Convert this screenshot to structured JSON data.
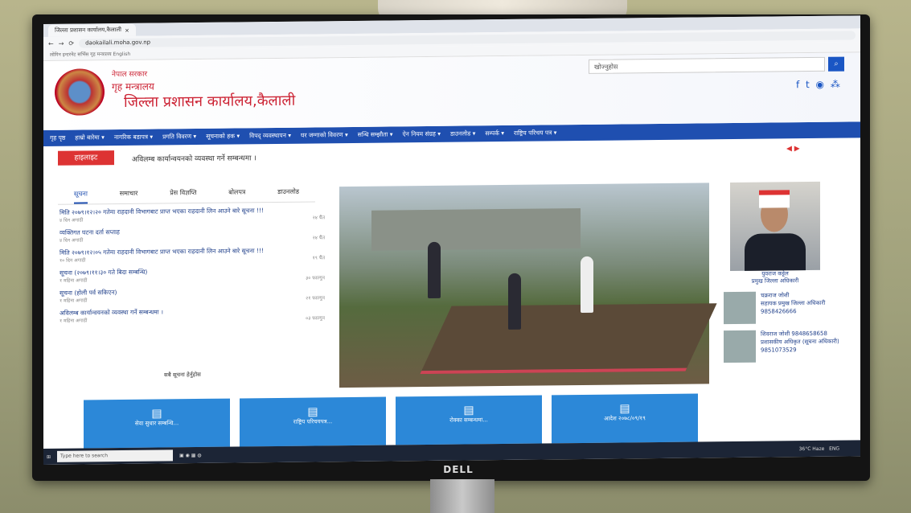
{
  "browser": {
    "tab_title": "जिल्ला प्रशासन कार्यालय,कैलाली",
    "url": "daokailali.moha.gov.np",
    "bookmarks": "लोगिन    इन्टरनेट सर्भिस    गृह मन्त्रालय    English"
  },
  "header": {
    "gov_line1": "नेपाल सरकार",
    "gov_line2": "गृह मन्त्रालय",
    "office": "जिल्ला प्रशासन कार्यालय,कैलाली",
    "search_placeholder": "खोज्नुहोस",
    "search_icon": "search-icon"
  },
  "nav": {
    "items": [
      "गृह पृष्ठ",
      "हाम्रो बारेमा ▾",
      "नागरिक बडापत्र ▾",
      "प्रगति विवरण ▾",
      "सूचनाको हक ▾",
      "विपद् व्यवस्थापन ▾",
      "घर जग्गाको विवरण ▾",
      "सन्धि सम्झौता ▾",
      "ऐन नियम संग्रह ▾",
      "डाउनलोड ▾",
      "सम्पर्क ▾",
      "राष्ट्रिय परिचय पत्र ▾"
    ]
  },
  "highlight": {
    "label": "हाइलाइट",
    "text": "अविलम्ब कार्यान्वयनको व्यवस्था गर्ने सम्बन्धमा ।"
  },
  "tabs": [
    "सूचना",
    "समाचार",
    "प्रेस विज्ञप्ति",
    "बोलपत्र",
    "डाउनलोड"
  ],
  "news": [
    {
      "title": "मिति २०७९।१२।२० गतेमा राहदानी विभागबाट प्राप्त भएका राहदानी लिन आउने बारे सूचना !!!",
      "meta": "४ दिन अगाडी",
      "date": "२४ चैत"
    },
    {
      "title": "व्यक्तिगत घटना दर्ता सप्ताह",
      "meta": "४ दिन अगाडी",
      "date": "२४ चैत"
    },
    {
      "title": "मिति २०७९।१२।०५ गतेमा राहदानी विभागबाट प्राप्त भएका राहदानी लिन आउने बारे सूचना !!!",
      "meta": "१० दिन अगाडी",
      "date": "१९ चैत"
    },
    {
      "title": "सूचना (२०७९।११।३० गते बिदा सम्बन्धि)",
      "meta": "१ महिना अगाडी",
      "date": "३० फाल्गुन"
    },
    {
      "title": "सूचना (होली पर्व सकिएन)",
      "meta": "१ महिना अगाडी",
      "date": "२१ फाल्गुन"
    },
    {
      "title": "अविलम्ब कार्यान्वयनको व्यवस्था गर्ने सम्बन्धमा ।",
      "meta": "१ महिना अगाडी",
      "date": "०३ फाल्गुन"
    }
  ],
  "more_notices": "सबै सूचना हेर्नुहोस",
  "side": {
    "chief_name": "युवराज कट्टेल",
    "chief_title": "प्रमुख जिल्ला अधिकारी",
    "staff1_name": "चक्रराज जोशी",
    "staff1_role": "सहायक प्रमुख जिल्ला अधिकारी",
    "staff1_phone": "9858426666",
    "staff2_name": "शिवराज जोशी 9848658658",
    "staff2_role": "प्रशासकीय अधिकृत (सूचना अधिकारी)",
    "staff2_phone": "9851073529"
  },
  "tiles": [
    "सेवा सुधार सम्बन्धि...",
    "राष्ट्रिय परिचयपत्र...",
    "रोक्का सम्बन्धमा...",
    "आदेश २०७८/०९/१९"
  ],
  "taskbar": {
    "search": "Type here to search",
    "weather": "36°C  Haze",
    "tray": "ENG"
  },
  "monitor_brand": "DELL"
}
